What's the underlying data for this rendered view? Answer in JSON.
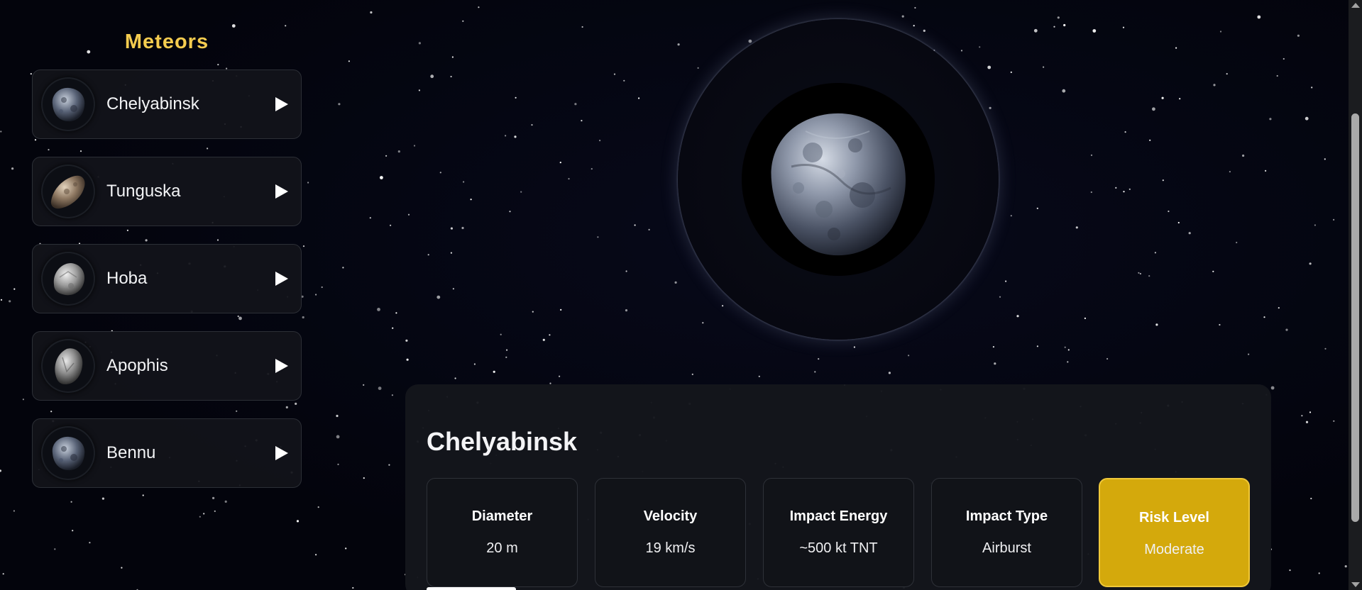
{
  "sidebar": {
    "title": "Meteors",
    "items": [
      {
        "label": "Chelyabinsk",
        "icon": "meteor-thumbnail",
        "play_icon": "play-icon"
      },
      {
        "label": "Tunguska",
        "icon": "meteor-thumbnail",
        "play_icon": "play-icon"
      },
      {
        "label": "Hoba",
        "icon": "meteor-thumbnail",
        "play_icon": "play-icon"
      },
      {
        "label": "Apophis",
        "icon": "meteor-thumbnail",
        "play_icon": "play-icon"
      },
      {
        "label": "Bennu",
        "icon": "meteor-thumbnail",
        "play_icon": "play-icon"
      }
    ]
  },
  "hero": {
    "image": "selected-meteor-image"
  },
  "details": {
    "title": "Chelyabinsk",
    "stats": [
      {
        "label": "Diameter",
        "value": "20 m"
      },
      {
        "label": "Velocity",
        "value": "19 km/s"
      },
      {
        "label": "Impact Energy",
        "value": "~500 kt TNT"
      },
      {
        "label": "Impact Type",
        "value": "Airburst"
      },
      {
        "label": "Risk Level",
        "value": "Moderate"
      }
    ]
  },
  "colors": {
    "accent_title": "#f5cc4f",
    "risk_moderate": "#d4a90c",
    "background": "#04050f",
    "panel": "#14161c"
  }
}
